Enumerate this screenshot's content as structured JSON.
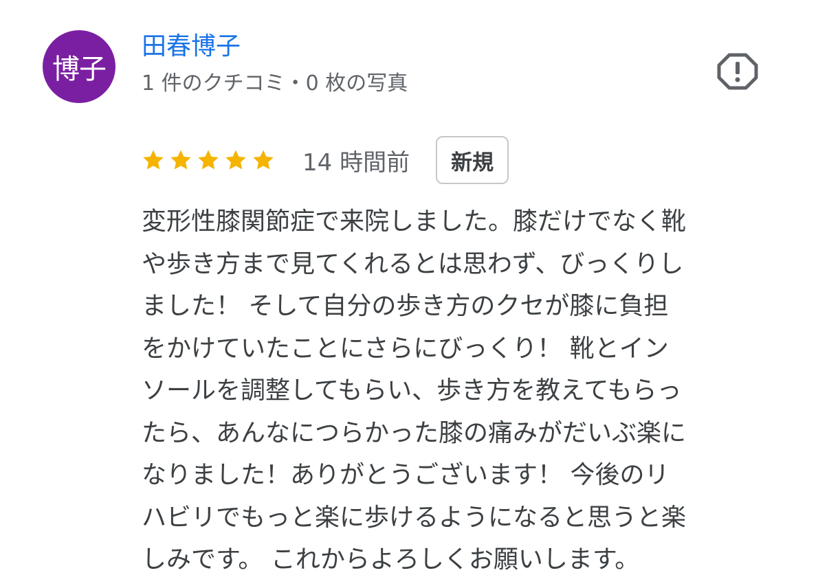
{
  "reviewer": {
    "avatar_text": "博子",
    "avatar_color": "#7b1fa2",
    "name": "田春博子",
    "meta": "1 件のクチコミ・0 枚の写真"
  },
  "actions": {
    "report_icon": "report-flag-icon"
  },
  "review": {
    "rating": 5,
    "max_rating": 5,
    "star_color": "#f4b400",
    "time": "14 時間前",
    "badge": "新規",
    "text": "変形性膝関節症で来院しました。膝だけでなく靴\nや歩き方まで見てくれるとは思わず、びっくりし\nました！ そして自分の歩き方のクセが膝に負担\nをかけていたことにさらにびっくり！ 靴とイン\nソールを調整してもらい、歩き方を教えてもらっ\nたら、あんなにつらかった膝の痛みがだいぶ楽に\nなりました！ありがとうございます！ 今後のリ\nハビリでもっと楽に歩けるようになると思うと楽\nしみです。 これからよろしくお願いします。"
  }
}
